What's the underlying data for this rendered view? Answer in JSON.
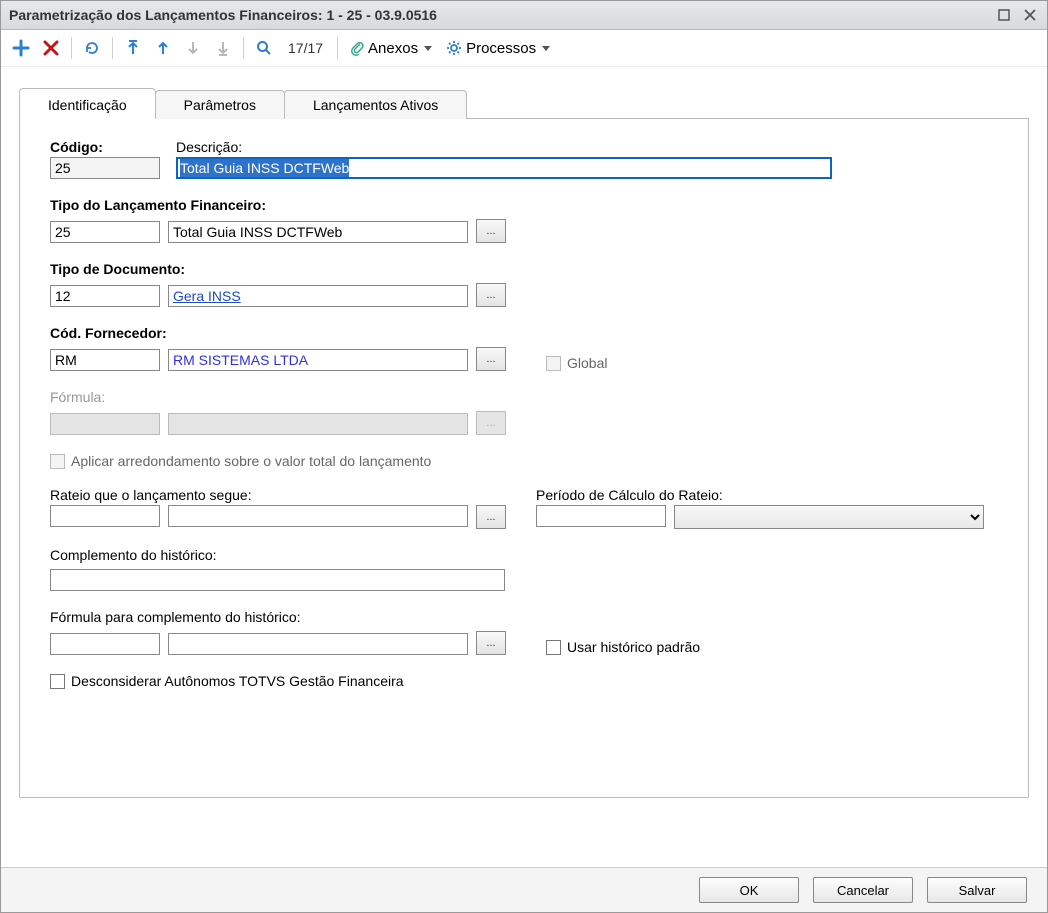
{
  "window": {
    "title": "Parametrização dos Lançamentos Financeiros: 1 - 25 - 03.9.0516"
  },
  "toolbar": {
    "record_indicator": "17/17",
    "anexos_label": "Anexos",
    "processos_label": "Processos"
  },
  "tabs": {
    "identificacao": "Identificação",
    "parametros": "Parâmetros",
    "lancamentos_ativos": "Lançamentos Ativos"
  },
  "labels": {
    "codigo": "Código:",
    "descricao": "Descrição:",
    "tipo_lanc": "Tipo do Lançamento Financeiro:",
    "tipo_doc": "Tipo de Documento:",
    "cod_fornecedor": "Cód. Fornecedor:",
    "formula": "Fórmula:",
    "aplicar_arred": "Aplicar arredondamento sobre o valor total do lançamento",
    "rateio": "Rateio que o lançamento segue:",
    "periodo": "Período de Cálculo do Rateio:",
    "complemento": "Complemento do histórico:",
    "formula_complemento": "Fórmula para complemento do histórico:",
    "usar_historico": "Usar histórico padrão",
    "desconsiderar": "Desconsiderar Autônomos TOTVS Gestão Financeira",
    "global": "Global"
  },
  "values": {
    "codigo": "25",
    "descricao": "Total Guia INSS DCTFWeb",
    "tipo_lanc_code": "25",
    "tipo_lanc_name": "Total Guia INSS DCTFWeb",
    "tipo_doc_code": "12",
    "tipo_doc_name": "Gera INSS",
    "fornecedor_code": "RM",
    "fornecedor_name": "RM SISTEMAS LTDA",
    "formula_code": "",
    "formula_name": "",
    "rateio_code": "",
    "rateio_name": "",
    "periodo_code": "",
    "complemento": "",
    "formula_comp_code": "",
    "formula_comp_name": ""
  },
  "footer": {
    "ok": "OK",
    "cancelar": "Cancelar",
    "salvar": "Salvar"
  }
}
